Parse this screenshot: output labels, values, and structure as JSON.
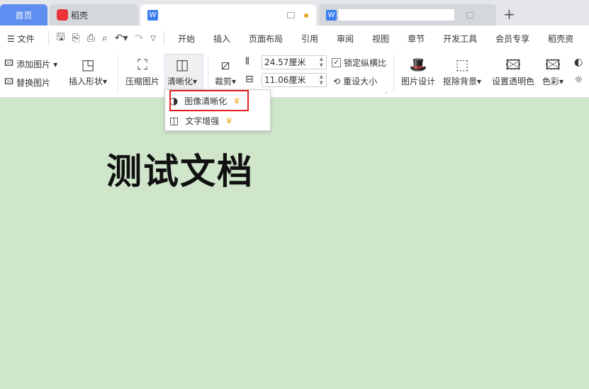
{
  "tabs": [
    {
      "label": "首页"
    },
    {
      "label": "稻壳"
    },
    {
      "label": ""
    },
    {
      "label": ""
    }
  ],
  "new_tab": "+",
  "menu": {
    "file": "文件",
    "items": [
      "开始",
      "插入",
      "页面布局",
      "引用",
      "审阅",
      "视图",
      "章节",
      "开发工具",
      "会员专享",
      "稻壳资"
    ]
  },
  "ribbon": {
    "add_picture": "添加图片",
    "replace_picture": "替换图片",
    "insert_shape": "插入形状",
    "compress": "压缩图片",
    "sharpen": "清晰化",
    "crop": "裁剪",
    "width": "24.57厘米",
    "height": "11.06厘米",
    "lock_ratio": "锁定纵横比",
    "lock_checked": true,
    "reset_size": "重设大小",
    "design": "图片设计",
    "remove_bg": "抠除背景",
    "transparent": "设置透明色",
    "color": "色彩"
  },
  "dropdown": {
    "items": [
      {
        "label": "图像清晰化",
        "icon": "circle-half-icon",
        "premium": true,
        "highlighted": true
      },
      {
        "label": "文字增强",
        "icon": "text-enhance-icon",
        "premium": true
      }
    ]
  },
  "document": {
    "title": "测试文档",
    "background": "#cfe6cb"
  }
}
